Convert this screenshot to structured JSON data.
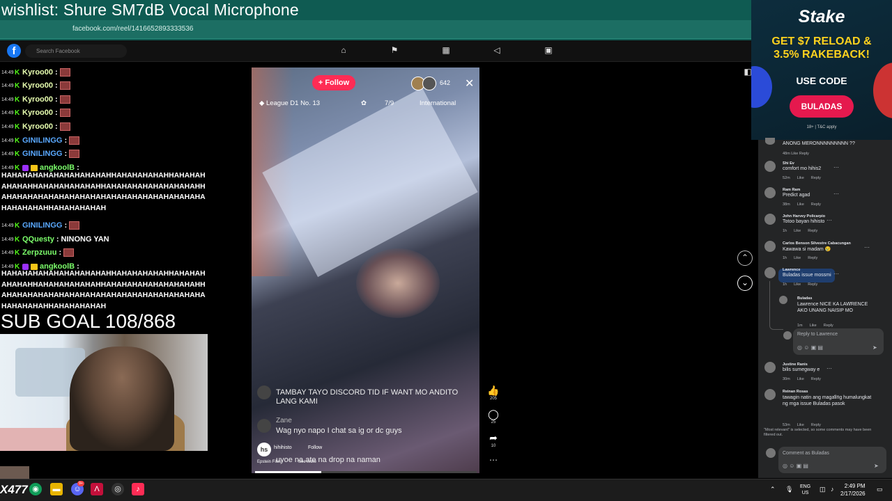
{
  "stream_overlay": {
    "wishlist": "wishlist: Shure SM7dB Vocal Microphone",
    "sub_goal": "SUB GOAL 108/868",
    "logo_text": "X477"
  },
  "browser": {
    "url": "facebook.com/reel/1416652893333536",
    "search_placeholder": "Search Facebook"
  },
  "chat": {
    "timestamp": "14:49",
    "lines": [
      {
        "user": "Kyroo00",
        "color": "#e8ffb0",
        "msg": ""
      },
      {
        "user": "Kyroo00",
        "color": "#e8ffb0",
        "msg": ""
      },
      {
        "user": "Kyroo00",
        "color": "#e8ffb0",
        "msg": ""
      },
      {
        "user": "Kyroo00",
        "color": "#e8ffb0",
        "msg": ""
      },
      {
        "user": "Kyroo00",
        "color": "#e8ffb0",
        "msg": ""
      },
      {
        "user": "GINILINGG",
        "color": "#5aa9ff",
        "msg": ""
      },
      {
        "user": "GINILINGG",
        "color": "#5aa9ff",
        "msg": ""
      },
      {
        "user": "angkoolB",
        "color": "#7cff6b",
        "msg": ""
      },
      {
        "user": "GINILINGG",
        "color": "#5aa9ff",
        "msg": ""
      },
      {
        "user": "QQuesty",
        "color": "#7cff6b",
        "msg": "NINONG YAN"
      },
      {
        "user": "Zerpzuuu",
        "color": "#7cff6b",
        "msg": ""
      },
      {
        "user": "angkoolB",
        "color": "#7cff6b",
        "msg": ""
      }
    ],
    "long_msg": "HAHAHAHAHAHAHAHAHAHAHHAHAHAHAHAHHAHAHAHAHAHAHHAHAHAHAHAHAHHAHAHAHAHAHAHAHAHAHHAHAHAHAHAHAHAHAHAHAHAHAHAHAHAHAHAHAHAHAHAHAHAHAHHAHAHAHAHAH"
  },
  "reel": {
    "follow_label": "+ Follow",
    "viewer_count": "642",
    "league": "League D1 No. 13",
    "progress_label": "7/9",
    "region": "International",
    "comments": [
      {
        "name": "",
        "text": "TAMBAY TAYO DISCORD TID IF WANT MO ANDITO LANG KAMI"
      },
      {
        "name": "Zane",
        "text": "Wag nyo napo I chat sa ig or dc guys"
      }
    ],
    "bottom_user": "hihihisto",
    "bottom_follow": "Follow",
    "bottom_caption": "Epstein Files",
    "see_more": "See more",
    "bottom_comment": "uyoe na ate na drop na naman",
    "likes": "205",
    "comment_count": "25",
    "shares": "10",
    "video_progress": 0.3
  },
  "ad": {
    "brand": "Stake",
    "headline": "GET $7 RELOAD & 3.5% RAKEBACK!",
    "use_code": "USE CODE",
    "code": "BULADAS",
    "fine_print": "18+ | T&C apply"
  },
  "fb_comments": {
    "top_text": "ANONG MERONNNNNNNNN ??",
    "top_meta": "48m   Like   Reply",
    "like": "Like",
    "reply": "Reply",
    "items": [
      {
        "name": "Shi Ev",
        "text": "comfort mo hihis2",
        "time": "52m"
      },
      {
        "name": "Ram Ram",
        "text": "Predict agad",
        "time": "38m"
      },
      {
        "name": "John Harvey Policarpio",
        "text": "Totoo bayan hihisto",
        "time": "1h"
      },
      {
        "name": "Carlos Benson Silvestre Cabacungan",
        "text": "Kawawa si madam 😢",
        "time": "1h"
      },
      {
        "name": "Lawrence",
        "text": "Buladas issue mossmi",
        "time": "1h"
      },
      {
        "name": "Buladas",
        "text": "Lawrence NICE KA LAWRENCE AKO UNANG NAISIP MO",
        "time": "1m"
      },
      {
        "name": "Justine Ranis",
        "text": "bilis sumegway e",
        "time": "30m"
      },
      {
        "name": "Reinan Rosas",
        "text": "tawagin natin ang magaling humalungkat ng mga issue Buladas pasok",
        "time": "53m"
      }
    ],
    "reply_placeholder": "Reply to Lawrence",
    "filter_note": "\"Most relevant\" is selected, so some comments may have been filtered out.",
    "comment_placeholder": "Comment as Buladas"
  },
  "taskbar": {
    "lang": "ENG",
    "region": "US",
    "time": "2:49 PM",
    "date": "2/17/2026",
    "discord_badge": "9+"
  }
}
